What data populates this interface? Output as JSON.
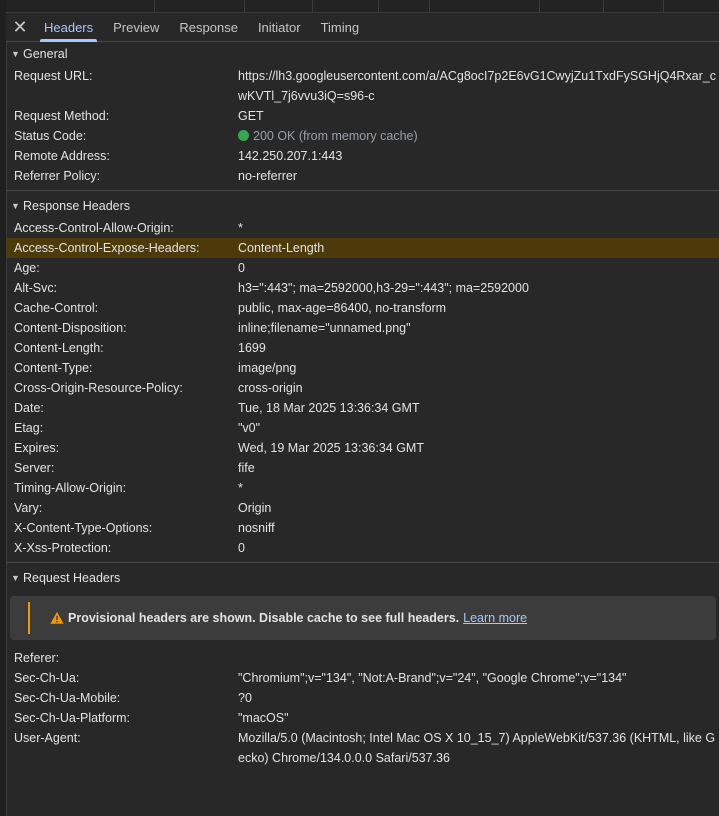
{
  "tabs": [
    {
      "label": "Headers"
    },
    {
      "label": "Preview"
    },
    {
      "label": "Response"
    },
    {
      "label": "Initiator"
    },
    {
      "label": "Timing"
    }
  ],
  "general": {
    "title": "General",
    "rows": [
      {
        "key": "Request URL:",
        "value": "https://lh3.googleusercontent.com/a/ACg8ocI7p2E6vG1CwyjZu1TxdFySGHjQ4Rxar_cwKVTl_7j6vvu3iQ=s96-c"
      },
      {
        "key": "Request Method:",
        "value": "GET"
      },
      {
        "key": "Status Code:",
        "value": "200 OK (from memory cache)",
        "status_color": "#34a853"
      },
      {
        "key": "Remote Address:",
        "value": "142.250.207.1:443"
      },
      {
        "key": "Referrer Policy:",
        "value": "no-referrer"
      }
    ]
  },
  "response_headers": {
    "title": "Response Headers",
    "rows": [
      {
        "key": "Access-Control-Allow-Origin:",
        "value": "*"
      },
      {
        "key": "Access-Control-Expose-Headers:",
        "value": "Content-Length"
      },
      {
        "key": "Age:",
        "value": "0"
      },
      {
        "key": "Alt-Svc:",
        "value": "h3=\":443\"; ma=2592000,h3-29=\":443\"; ma=2592000"
      },
      {
        "key": "Cache-Control:",
        "value": "public, max-age=86400, no-transform"
      },
      {
        "key": "Content-Disposition:",
        "value": "inline;filename=\"unnamed.png\""
      },
      {
        "key": "Content-Length:",
        "value": "1699"
      },
      {
        "key": "Content-Type:",
        "value": "image/png"
      },
      {
        "key": "Cross-Origin-Resource-Policy:",
        "value": "cross-origin"
      },
      {
        "key": "Date:",
        "value": "Tue, 18 Mar 2025 13:36:34 GMT"
      },
      {
        "key": "Etag:",
        "value": "\"v0\""
      },
      {
        "key": "Expires:",
        "value": "Wed, 19 Mar 2025 13:36:34 GMT"
      },
      {
        "key": "Server:",
        "value": "fife"
      },
      {
        "key": "Timing-Allow-Origin:",
        "value": "*"
      },
      {
        "key": "Vary:",
        "value": "Origin"
      },
      {
        "key": "X-Content-Type-Options:",
        "value": "nosniff"
      },
      {
        "key": "X-Xss-Protection:",
        "value": "0"
      }
    ]
  },
  "request_headers": {
    "title": "Request Headers",
    "warning": {
      "text": "Provisional headers are shown. Disable cache to see full headers.",
      "link": "Learn more",
      "icon": "warning-icon",
      "color": "#f29900"
    },
    "rows": [
      {
        "key": "Referer:",
        "value": ""
      },
      {
        "key": "Sec-Ch-Ua:",
        "value": "\"Chromium\";v=\"134\", \"Not:A-Brand\";v=\"24\", \"Google Chrome\";v=\"134\""
      },
      {
        "key": "Sec-Ch-Ua-Mobile:",
        "value": "?0"
      },
      {
        "key": "Sec-Ch-Ua-Platform:",
        "value": "\"macOS\""
      },
      {
        "key": "User-Agent:",
        "value": "Mozilla/5.0 (Macintosh; Intel Mac OS X 10_15_7) AppleWebKit/537.36 (KHTML, like Gecko) Chrome/134.0.0.0 Safari/537.36"
      }
    ]
  },
  "colors": {
    "accent": "#a8c7fa",
    "highlight_row": "#4c3a0a",
    "ok": "#34a853"
  }
}
